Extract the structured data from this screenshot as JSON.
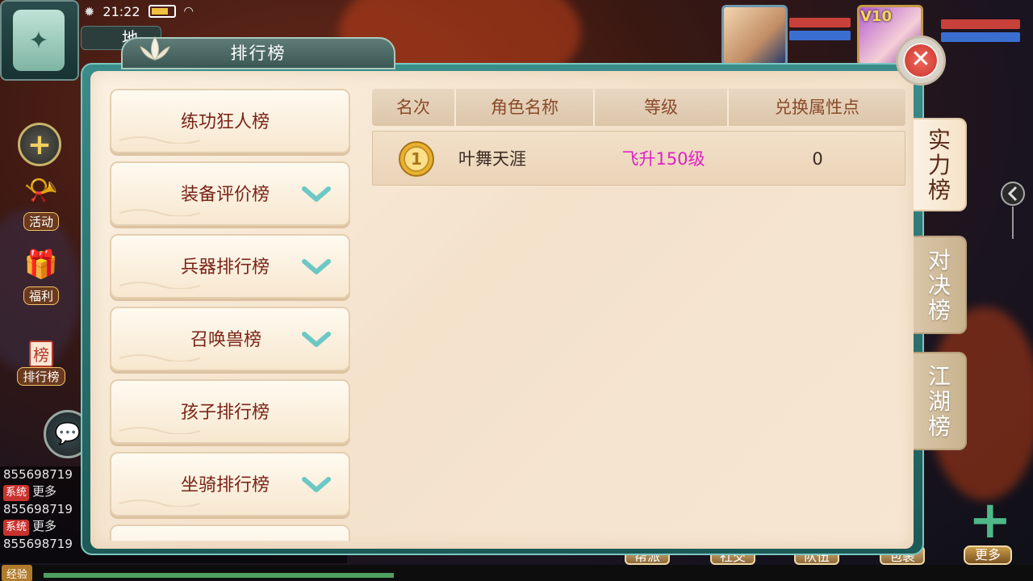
{
  "status": {
    "time": "21:22"
  },
  "hud": {
    "map_partial_label": "地",
    "activity_label": "活动",
    "welfare_label": "福利",
    "ranking_label": "排行榜",
    "ranking_badge": "榜",
    "vip_badge": "V10",
    "exp_label": "经验",
    "bottom_buttons": [
      "帮派",
      "社交",
      "队伍",
      "包裹"
    ],
    "more_label": "更多"
  },
  "chat": {
    "lines": [
      {
        "sys": "",
        "text": "855698719"
      },
      {
        "sys": "系统",
        "text": "更多"
      },
      {
        "sys": "",
        "text": "855698719"
      },
      {
        "sys": "系统",
        "text": "更多"
      },
      {
        "sys": "",
        "text": "855698719"
      }
    ]
  },
  "panel": {
    "title": "排行榜",
    "categories": [
      {
        "label": "练功狂人榜",
        "expandable": false
      },
      {
        "label": "装备评价榜",
        "expandable": true
      },
      {
        "label": "兵器排行榜",
        "expandable": true
      },
      {
        "label": "召唤兽榜",
        "expandable": true
      },
      {
        "label": "孩子排行榜",
        "expandable": false
      },
      {
        "label": "坐骑排行榜",
        "expandable": true
      }
    ],
    "table": {
      "headers": [
        "名次",
        "角色名称",
        "等级",
        "兑换属性点"
      ],
      "rows": [
        {
          "rank": "1",
          "name": "叶舞天涯",
          "level": "飞升150级",
          "points": "0"
        }
      ]
    },
    "tabs": [
      {
        "label": "实力榜",
        "active": true
      },
      {
        "label": "对决榜",
        "active": false
      },
      {
        "label": "江湖榜",
        "active": false
      }
    ]
  },
  "colors": {
    "accent_teal": "#3a8c8a",
    "panel_bg": "#f4e2cb",
    "category_text": "#7a2418",
    "level_text": "#e020c8",
    "chevron": "#6cc8c4"
  }
}
